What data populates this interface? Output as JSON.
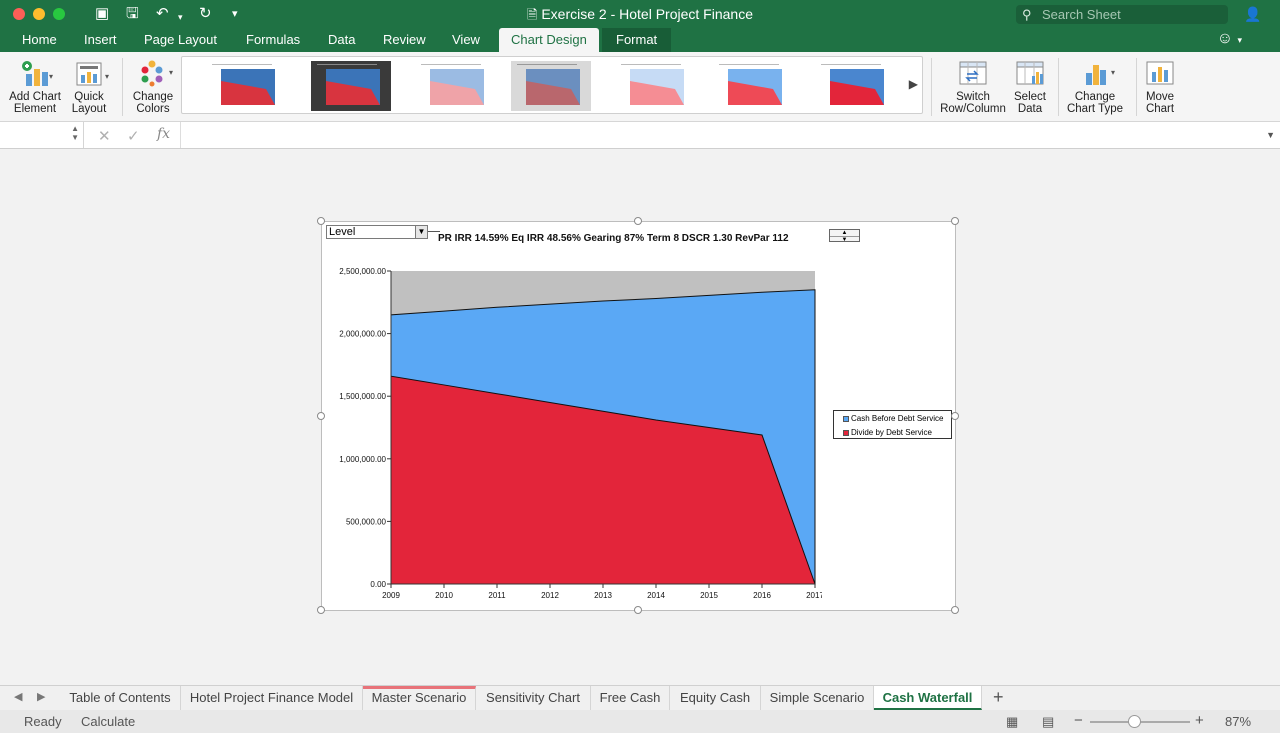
{
  "window": {
    "title": "Exercise 2 - Hotel Project Finance"
  },
  "search": {
    "placeholder": "Search Sheet"
  },
  "ribbon_tabs": [
    {
      "label": "Home"
    },
    {
      "label": "Insert"
    },
    {
      "label": "Page Layout"
    },
    {
      "label": "Formulas"
    },
    {
      "label": "Data"
    },
    {
      "label": "Review"
    },
    {
      "label": "View"
    },
    {
      "label": "Chart Design"
    },
    {
      "label": "Format"
    }
  ],
  "ribbon": {
    "add_chart_element": [
      "Add Chart",
      "Element"
    ],
    "quick_layout": [
      "Quick",
      "Layout"
    ],
    "change_colors": [
      "Change",
      "Colors"
    ],
    "switch_row_column": [
      "Switch",
      "Row/Column"
    ],
    "select_data": [
      "Select",
      "Data"
    ],
    "change_chart_type": [
      "Change",
      "Chart Type"
    ],
    "move_chart": [
      "Move",
      "Chart"
    ]
  },
  "formula_bar": {
    "fx": "fx"
  },
  "chart": {
    "dropdown_value": "Level",
    "title": "PR IRR 14.59% Eq IRR 48.56% Gearing 87% Term  8 DSCR  1.30  RevPar 112",
    "legend": [
      "Cash Before Debt Service",
      "Divide by Debt Service"
    ]
  },
  "chart_data": {
    "type": "area",
    "x": [
      2009,
      2010,
      2011,
      2012,
      2013,
      2014,
      2015,
      2016,
      2017
    ],
    "ylim": [
      0,
      2500000
    ],
    "yticks": [
      "2,500,000.00",
      "2,000,000.00",
      "1,500,000.00",
      "1,000,000.00",
      "500,000.00",
      "0.00"
    ],
    "ytick_values": [
      2500000,
      2000000,
      1500000,
      1000000,
      500000,
      0
    ],
    "series": [
      {
        "name": "Cash Before Debt Service",
        "color": "#5aa8f5",
        "values": [
          2150000,
          2180000,
          2210000,
          2235000,
          2260000,
          2280000,
          2305000,
          2330000,
          2350000
        ]
      },
      {
        "name": "Divide by Debt Service",
        "color": "#e3253a",
        "values": [
          1660000,
          1590000,
          1520000,
          1450000,
          1380000,
          1310000,
          1250000,
          1190000,
          0
        ]
      }
    ],
    "plot_background": "#c0c0c0"
  },
  "sheet_tabs": [
    {
      "label": "Table of Contents"
    },
    {
      "label": "Hotel Project Finance Model"
    },
    {
      "label": "Master Scenario"
    },
    {
      "label": "Sensitivity Chart"
    },
    {
      "label": "Free Cash"
    },
    {
      "label": "Equity Cash"
    },
    {
      "label": "Simple Scenario"
    },
    {
      "label": "Cash Waterfall"
    }
  ],
  "status": {
    "ready": "Ready",
    "calculate": "Calculate",
    "zoom": "87%"
  },
  "colors": {
    "excel_green": "#1f7244"
  }
}
